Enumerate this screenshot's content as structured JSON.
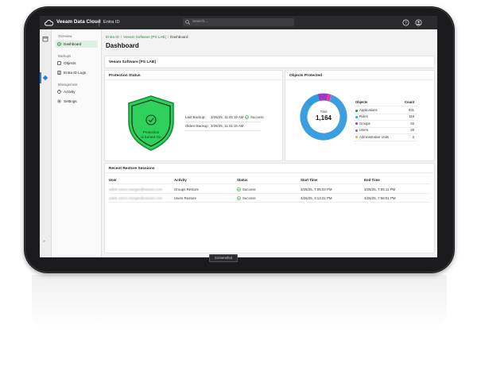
{
  "topbar": {
    "app_title": "Veeam Data Cloud",
    "product": "Entra ID",
    "search_placeholder": "Search..."
  },
  "sidebar": {
    "groups": [
      {
        "label": "Overview",
        "items": [
          {
            "label": "Dashboard",
            "icon": "dashboard-icon",
            "active": true
          }
        ]
      },
      {
        "label": "Backups",
        "items": [
          {
            "label": "Objects",
            "icon": "objects-icon"
          },
          {
            "label": "Entra ID Logs",
            "icon": "logs-icon"
          }
        ]
      },
      {
        "label": "Management",
        "items": [
          {
            "label": "Activity",
            "icon": "activity-icon"
          },
          {
            "label": "Settings",
            "icon": "gear-icon"
          }
        ]
      }
    ],
    "collapse_label": "»"
  },
  "breadcrumb": {
    "items": [
      "Entra ID",
      "Veeam Software [PS LAB]"
    ],
    "current": "Dashboard",
    "divider": "/"
  },
  "page_title": "Dashboard",
  "tenant_title": "Veeam Software [PS LAB]",
  "protection": {
    "title": "Protection Status",
    "shield_text_line1": "Protection",
    "shield_text_line2": "is turned On",
    "last_backup_label": "Last Backup:",
    "last_backup_value": "3/26/25, 11:43:19 AM",
    "last_backup_status": "Success",
    "oldest_backup_label": "Oldest Backup:",
    "oldest_backup_value": "3/26/25, 11:41:15 AM"
  },
  "objects": {
    "title": "Objects Protected",
    "total_label": "Total",
    "total_value": "1,164",
    "col_objects": "Objects",
    "col_count": "Count",
    "rows": [
      {
        "name": "Applications",
        "count": "931",
        "color": "#2b8a3e"
      },
      {
        "name": "Roles",
        "count": "119",
        "color": "#2d9be0"
      },
      {
        "name": "Groups",
        "count": "83",
        "color": "#9a3cc2"
      },
      {
        "name": "Users",
        "count": "28",
        "color": "#e23aa5"
      },
      {
        "name": "Administrative Units",
        "count": "3",
        "color": "#e8b020"
      }
    ]
  },
  "sessions": {
    "title": "Recent Restore Sessions",
    "headers": [
      "User",
      "Activity",
      "Status",
      "Start Time",
      "End Time"
    ],
    "rows": [
      {
        "user": "adele.vance.morgan@veeam.com",
        "activity": "Groups Restore",
        "status": "Success",
        "start": "3/26/25, 7:05:03 PM",
        "end": "3/26/25, 7:05:11 PM"
      },
      {
        "user": "adele.vance.morgan@veeam.com",
        "activity": "Users Restore",
        "status": "Success",
        "start": "3/26/25, 3:13:21 PM",
        "end": "3/26/25, 7:58:01 PM"
      }
    ]
  },
  "caption": "Screenshot",
  "colors": {
    "accent_green": "#2b8a3e",
    "shield_green": "#2fd15c",
    "donut_blue": "#3a9ee0",
    "topbar": "#2b2b2d"
  }
}
